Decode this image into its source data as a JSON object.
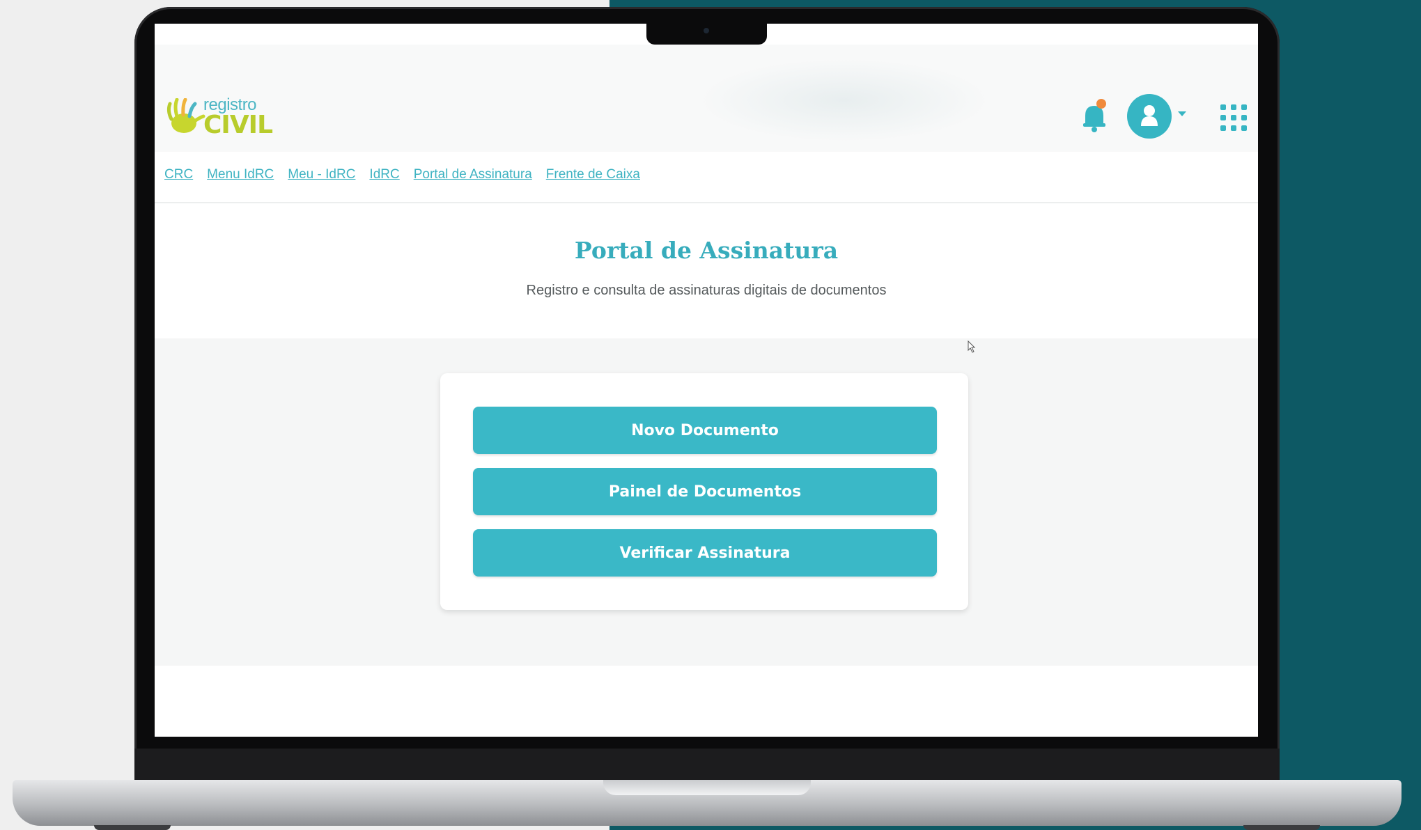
{
  "app": {
    "logo_text_small": "registro",
    "logo_text_big": "CIVIL"
  },
  "header": {
    "icons": [
      "bell-icon",
      "user-avatar-icon",
      "apps-grid-icon"
    ],
    "notification_badge_color": "#f08a3c",
    "accent_color": "#36b5c3"
  },
  "nav": {
    "links": [
      "CRC",
      "Menu IdRC",
      "Meu - IdRC",
      "IdRC",
      "Portal de Assinatura",
      "Frente de Caixa"
    ]
  },
  "page": {
    "title": "Portal de Assinatura",
    "subtitle": "Registro e consulta de assinaturas digitais de documentos"
  },
  "actions": {
    "new_document": "Novo Documento",
    "documents_panel": "Painel de Documentos",
    "verify_signature": "Verificar Assinatura"
  },
  "colors": {
    "background_left": "#efefef",
    "background_right": "#0d5964",
    "button": "#3ab8c7",
    "title": "#37acbc",
    "logo_green": "#b8cc2c"
  }
}
